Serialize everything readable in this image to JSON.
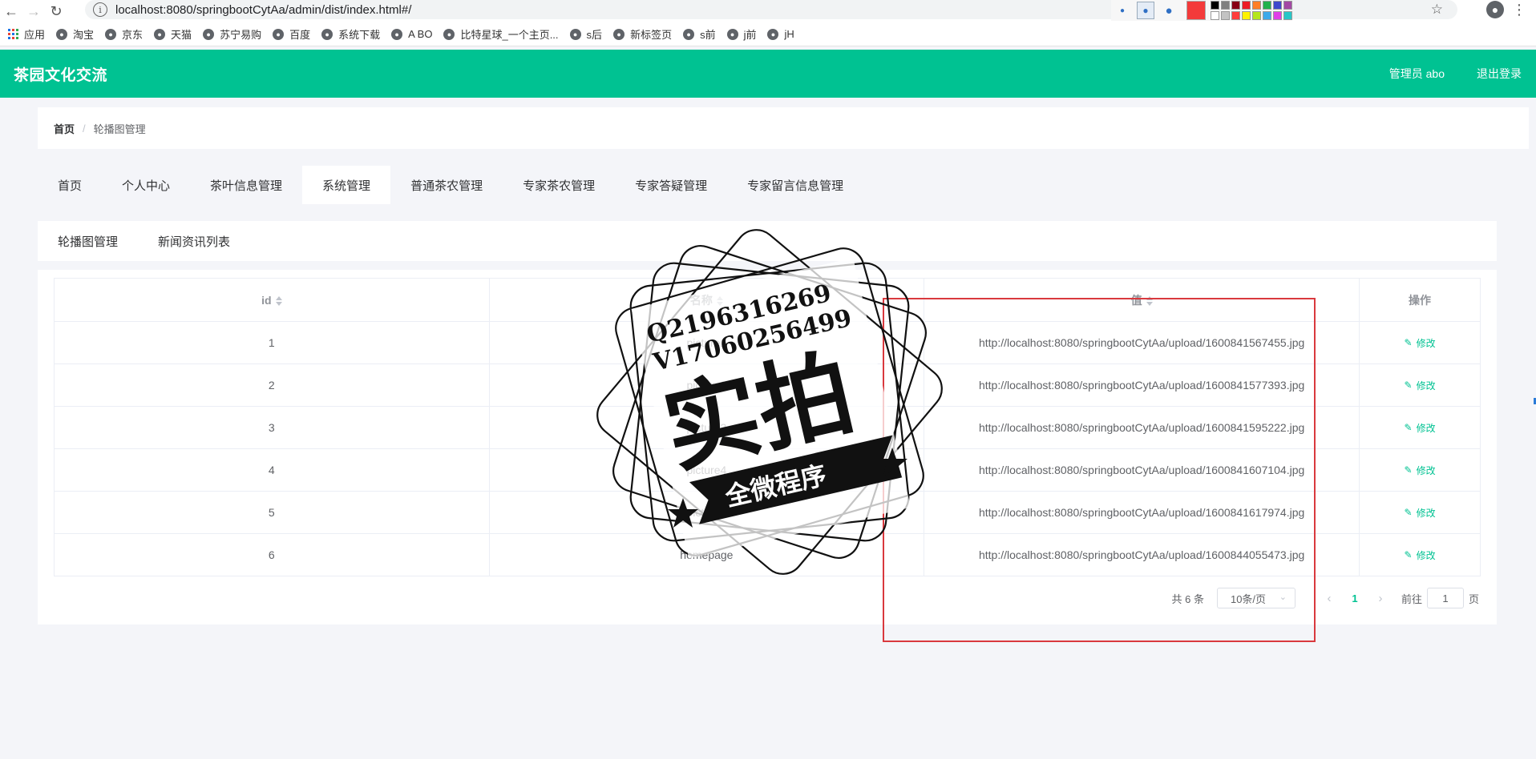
{
  "browser": {
    "url": "localhost:8080/springbootCytAa/admin/dist/index.html#/",
    "bookmarks": [
      "应用",
      "淘宝",
      "京东",
      "天猫",
      "苏宁易购",
      "百度",
      "系统下载",
      "A BO",
      "比特星球_一个主页...",
      "s后",
      "新标签页",
      "s前",
      "j前",
      "jH"
    ],
    "swatch_colors": [
      "#000000",
      "#7f7f7f",
      "#880015",
      "#ed1c24",
      "#ff7f27",
      "#22b14c",
      "#3f48cc",
      "#a349a4",
      "#ffffff",
      "#c3c3c3",
      "#ff3b3b",
      "#fff200",
      "#b5e61d",
      "#3da9ea",
      "#e03ee8",
      "#27c7c7"
    ]
  },
  "app": {
    "title": "茶园文化交流",
    "admin_label": "管理员 abo",
    "logout": "退出登录",
    "accent_color": "#00c292"
  },
  "breadcrumb": {
    "home": "首页",
    "separator": "/",
    "current": "轮播图管理"
  },
  "top_tabs": [
    "首页",
    "个人中心",
    "茶叶信息管理",
    "系统管理",
    "普通茶农管理",
    "专家茶农管理",
    "专家答疑管理",
    "专家留言信息管理"
  ],
  "top_tabs_active": "系统管理",
  "sub_tabs": [
    "轮播图管理",
    "新闻资讯列表"
  ],
  "table": {
    "headers": [
      "id",
      "名称",
      "值",
      "操作"
    ],
    "edit_label": "修改",
    "rows": [
      {
        "id": "1",
        "name": "picture1",
        "value": "http://localhost:8080/springbootCytAa/upload/1600841567455.jpg"
      },
      {
        "id": "2",
        "name": "picture2",
        "value": "http://localhost:8080/springbootCytAa/upload/1600841577393.jpg"
      },
      {
        "id": "3",
        "name": "picture3",
        "value": "http://localhost:8080/springbootCytAa/upload/1600841595222.jpg"
      },
      {
        "id": "4",
        "name": "picture4",
        "value": "http://localhost:8080/springbootCytAa/upload/1600841607104.jpg"
      },
      {
        "id": "5",
        "name": "picture5",
        "value": "http://localhost:8080/springbootCytAa/upload/1600841617974.jpg"
      },
      {
        "id": "6",
        "name": "homepage",
        "value": "http://localhost:8080/springbootCytAa/upload/1600844055473.jpg"
      }
    ]
  },
  "pagination": {
    "total": "共 6 条",
    "page_size": "10条/页",
    "current_page": "1",
    "goto_prefix": "前往",
    "goto_value": "1",
    "goto_suffix": "页"
  },
  "watermark": {
    "line1": "Q2196316269",
    "line2": "V17060256499",
    "big": "实拍",
    "ribbon": "全微程序"
  }
}
